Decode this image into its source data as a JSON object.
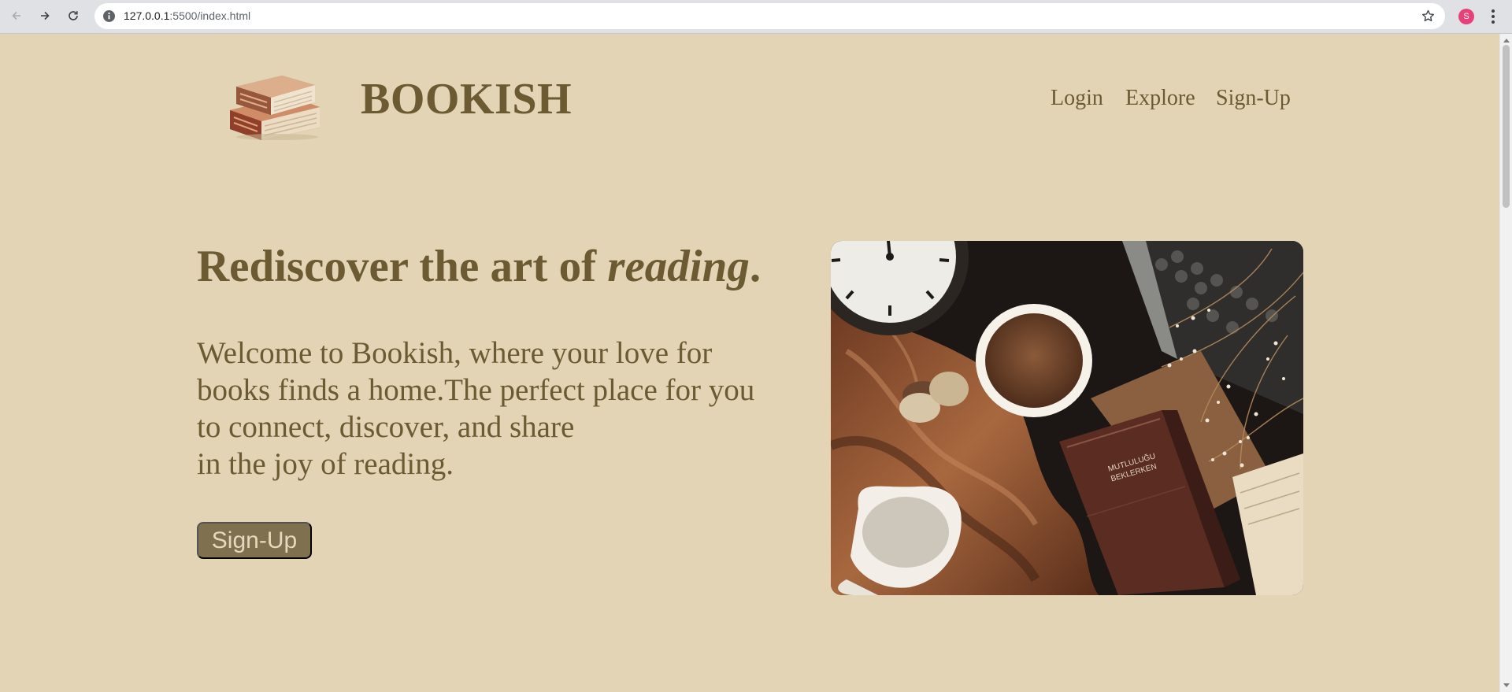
{
  "browser": {
    "url_host": "127.0.0.1",
    "url_path": ":5500/index.html",
    "profile_initial": "S"
  },
  "header": {
    "brand": "BOOKISH",
    "nav": [
      "Login",
      "Explore",
      "Sign-Up"
    ]
  },
  "hero": {
    "headline_prefix": "Rediscover the art of ",
    "headline_emphasis": "reading",
    "headline_suffix": ".",
    "intro_lines": [
      "Welcome to Bookish, where your love for",
      "books finds a home.The perfect place for you",
      "to connect, discover, and share",
      "in the joy of reading."
    ],
    "cta_label": "Sign-Up",
    "book_title_lines": [
      "MUTLULUĞU",
      "BEKLERKEN"
    ]
  },
  "colors": {
    "page_background": "#e2d4b5",
    "text": "#6b5a32",
    "button": "#7f7050",
    "button_text": "#e5d8bc"
  }
}
